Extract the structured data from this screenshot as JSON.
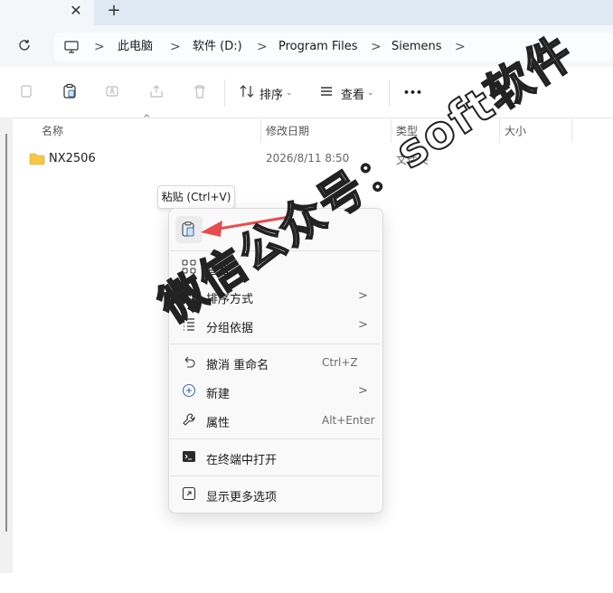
{
  "tabbar": {
    "close_glyph": "✕",
    "new_tab_glyph": "+"
  },
  "address": {
    "crumbs": [
      "此电脑",
      "软件 (D:)",
      "Program Files",
      "Siemens"
    ]
  },
  "toolbar": {
    "sort_label": "排序",
    "view_label": "查看",
    "more_glyph": "•••"
  },
  "columns": {
    "name": "名称",
    "modified": "修改日期",
    "type": "类型",
    "size": "大小"
  },
  "files": [
    {
      "name": "NX2506",
      "modified": "2026/8/11 8:50",
      "type": "文件夹"
    }
  ],
  "tooltip": "粘贴 (Ctrl+V)",
  "context_menu": {
    "view": "查看",
    "sort_by": "排序方式",
    "group_by": "分组依据",
    "undo_rename": "撤消 重命名",
    "undo_shortcut": "Ctrl+Z",
    "new": "新建",
    "properties": "属性",
    "properties_shortcut": "Alt+Enter",
    "open_terminal": "在终端中打开",
    "show_more": "显示更多选项"
  },
  "watermark": "微信公众号：soft软件",
  "colors": {
    "arrow": "#e74c4c",
    "accent": "#3a6fb0",
    "folder": "#f7c548"
  }
}
